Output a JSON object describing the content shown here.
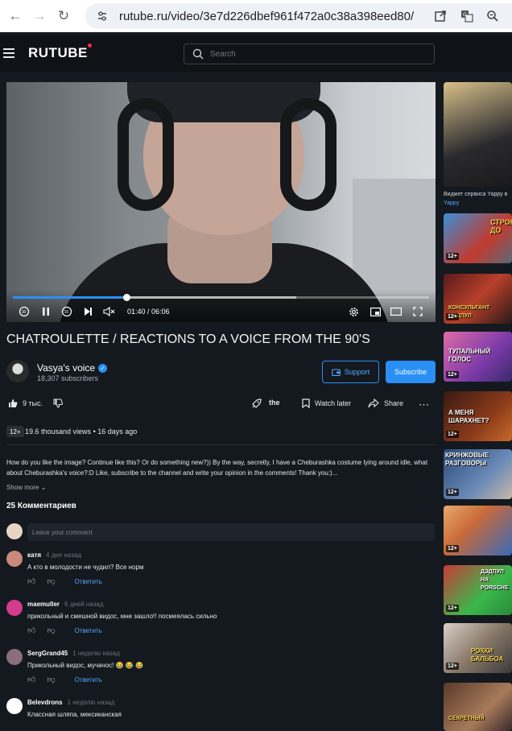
{
  "browser": {
    "url": "rutube.ru/video/3e7d226dbef961f472a0c38a398eed80/"
  },
  "header": {
    "logo": "RUTUBE",
    "search_placeholder": "Search"
  },
  "player": {
    "time": "01:40 / 06:06",
    "progress_fraction": 0.273,
    "buffered_fraction": 0.68
  },
  "video": {
    "title": "CHATROULETTE / REACTIONS TO A VOICE FROM THE 90'S",
    "channel": "Vasya's voice",
    "subscribers": "18,307 subscribers",
    "support_label": "Support",
    "subscribe_label": "Subscribe",
    "likes": "9 тыс.",
    "share_fragment": "the",
    "watch_later": "Watch later",
    "share": "Share",
    "age": "12+",
    "views": "19.6 thousand views",
    "date": "16 days ago",
    "description": "How do you like the image? Continue like this? Or do something new?)) By the way, secretly, I have a Cheburashka costume lying around idle, what about Cheburashka's voice?:D Like, subscribe to the channel and write your opinion in the comments! Thank you:)...",
    "show_more": "Show more"
  },
  "comments": {
    "count_label": "25 Комментариев",
    "input_placeholder": "Leave your comment",
    "reply_label": "Ответить",
    "items": [
      {
        "user": "катя",
        "time": "4 дня назад",
        "text": "А кто в молодости не чудил? Все норм"
      },
      {
        "user": "maemuller",
        "time": "6 дней назад",
        "text": "прикольный и смешной видос, мне зашло!! посмеялась сильно"
      },
      {
        "user": "SergGrand45",
        "time": "1 неделю назад",
        "text": "Прикольный видос, мучачос! 😂 😂 😂"
      },
      {
        "user": "Belevdrons",
        "time": "1 неделю назад",
        "text": "Классная шляпа, мексиканская"
      }
    ]
  },
  "sidebar": {
    "first_caption": "Виджет сервиса Yappy в",
    "first_source": "Yappy",
    "items": [
      {
        "age": "12+",
        "caption": "СТРОЮ ДО"
      },
      {
        "age": "12+",
        "caption": "КОНСУЛЬТАНТ ДЭДПУЛ"
      },
      {
        "age": "12+",
        "caption": "ТУПАЛЬНЫЙ ГОЛОС"
      },
      {
        "age": "12+",
        "caption": "А МЕНЯ ШАРАХНЕТ?"
      },
      {
        "age": "12+",
        "caption": "КРИНЖОВЫЕ РАЗГОВОРЫ"
      },
      {
        "age": "12+",
        "caption": ""
      },
      {
        "age": "12+",
        "caption": "ДЭДПУЛ НА PORSCHE"
      },
      {
        "age": "12+",
        "caption": "РОККИ БАЛЬБОА"
      },
      {
        "age": "",
        "caption": "СЕКРЕТНЫЙ"
      }
    ]
  },
  "colors": {
    "accent": "#2a8ff5",
    "background": "#14191f",
    "logo_dot": "#ff2b4a"
  }
}
